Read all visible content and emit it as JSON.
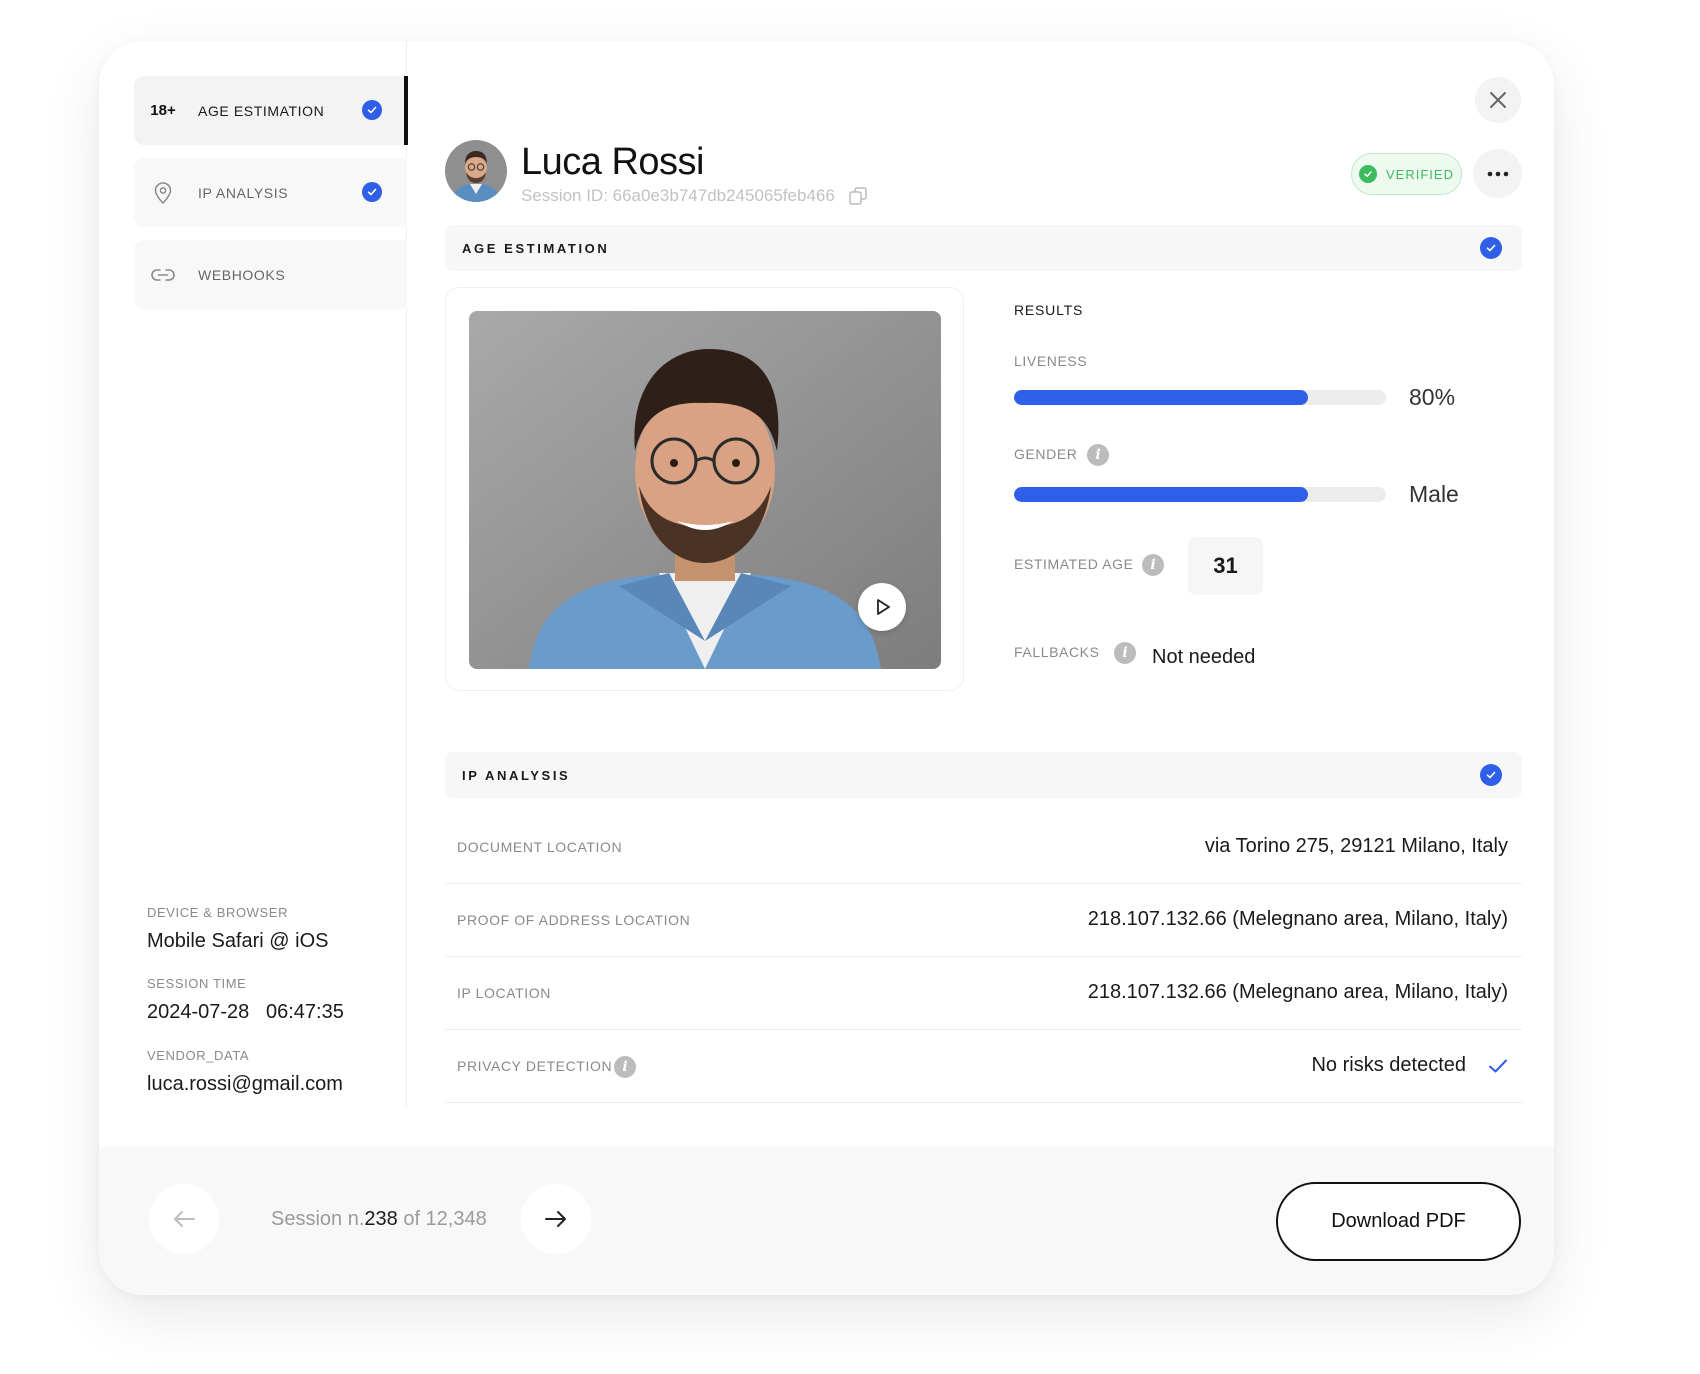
{
  "sidebar": {
    "items": [
      {
        "icon": "18+",
        "label": "AGE ESTIMATION",
        "checked": true
      },
      {
        "icon": "location-pin-icon",
        "label": "IP ANALYSIS",
        "checked": true
      },
      {
        "icon": "link-icon",
        "label": "WEBHOOKS",
        "checked": false
      }
    ],
    "meta": {
      "device_label": "DEVICE & BROWSER",
      "device_value": "Mobile Safari @ iOS",
      "time_label": "SESSION TIME",
      "time_value": "2024-07-28   06:47:35",
      "vendor_label": "VENDOR_DATA",
      "vendor_value": "luca.rossi@gmail.com"
    }
  },
  "header": {
    "name": "Luca Rossi",
    "session_id": "Session ID: 66a0e3b747db245065feb466",
    "status": "VERIFIED"
  },
  "age_section": {
    "title": "AGE ESTIMATION",
    "results_heading": "RESULTS",
    "liveness_label": "LIVENESS",
    "liveness_value": "80%",
    "liveness_fraction": 0.79,
    "gender_label": "GENDER",
    "gender_value": "Male",
    "gender_fraction": 0.79,
    "age_label": "ESTIMATED AGE",
    "age_value": "31",
    "fallbacks_label": "FALLBACKS",
    "fallbacks_value": "Not needed"
  },
  "ip_section": {
    "title": "IP ANALYSIS",
    "rows": [
      {
        "label": "DOCUMENT LOCATION",
        "value": "via Torino 275, 29121 Milano, Italy"
      },
      {
        "label": "PROOF OF ADDRESS LOCATION",
        "value": "218.107.132.66 (Melegnano area, Milano, Italy)"
      },
      {
        "label": "IP LOCATION",
        "value": "218.107.132.66 (Melegnano area, Milano, Italy)"
      },
      {
        "label": "PRIVACY DETECTION",
        "value": "No risks detected"
      }
    ]
  },
  "footer": {
    "session_prefix": "Session n.",
    "session_number": "238",
    "session_suffix": " of 12,348",
    "download_label": "Download PDF"
  },
  "colors": {
    "accent": "#2f5fe8",
    "verified_green": "#3cbc5e"
  }
}
